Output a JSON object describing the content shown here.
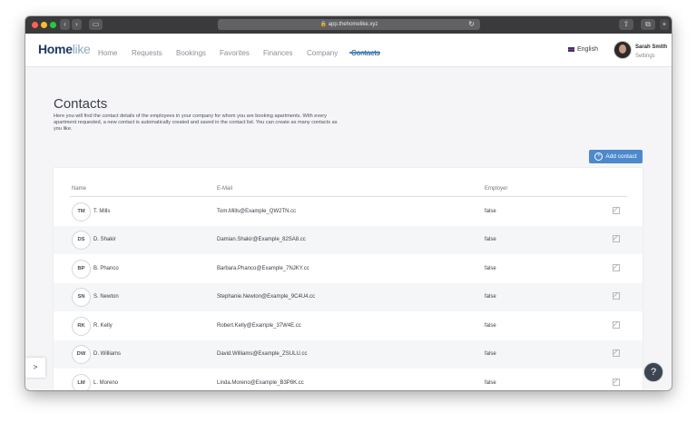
{
  "browser": {
    "url": "app.thehomelike.xyz",
    "lock_icon": "lock-icon",
    "reload_icon": "reload-icon"
  },
  "nav": {
    "logo_bold": "Home",
    "logo_light": "like",
    "links": [
      "Home",
      "Requests",
      "Bookings",
      "Favorites",
      "Finances",
      "Company",
      "Contacts"
    ],
    "active": "Contacts",
    "language": "English",
    "user_name": "Sarah Smith",
    "user_settings": "Settings"
  },
  "page": {
    "title": "Contacts",
    "description": "Here you will find the contact details of the employees in your company for whom you are booking apartments. With every apartment requested, a new contact is automatically created and saved in the contact list. You can create as many contacts as you like.",
    "add_button": "Add contact"
  },
  "table": {
    "headers": [
      "Name",
      "E-Mail",
      "Employer"
    ],
    "rows": [
      {
        "initials": "TM",
        "name": "T. Mills",
        "email": "Tom.Mills@Example_QW2TN.cc",
        "employer": "false"
      },
      {
        "initials": "DS",
        "name": "D. Shakir",
        "email": "Damian.Shakir@Example_82SA8.cc",
        "employer": "false"
      },
      {
        "initials": "BP",
        "name": "B. Phanco",
        "email": "Barbara.Phanco@Example_7NJKY.cc",
        "employer": "false"
      },
      {
        "initials": "SN",
        "name": "S. Newton",
        "email": "Stephanie.Newton@Example_9C4U4.cc",
        "employer": "false"
      },
      {
        "initials": "RK",
        "name": "R. Kelly",
        "email": "Robert.Kelly@Example_37W4E.cc",
        "employer": "false"
      },
      {
        "initials": "DW",
        "name": "D. Williams",
        "email": "David.Williams@Example_ZSULU.cc",
        "employer": "false"
      },
      {
        "initials": "LM",
        "name": "L. Moreno",
        "email": "Linda.Moreno@Example_B3P8K.cc",
        "employer": "false"
      }
    ]
  },
  "side_tab": ">",
  "help": "?",
  "colors": {
    "accent": "#4d89cc",
    "nav_underline": "#3a8bd7",
    "logo": "#1f3b63"
  }
}
